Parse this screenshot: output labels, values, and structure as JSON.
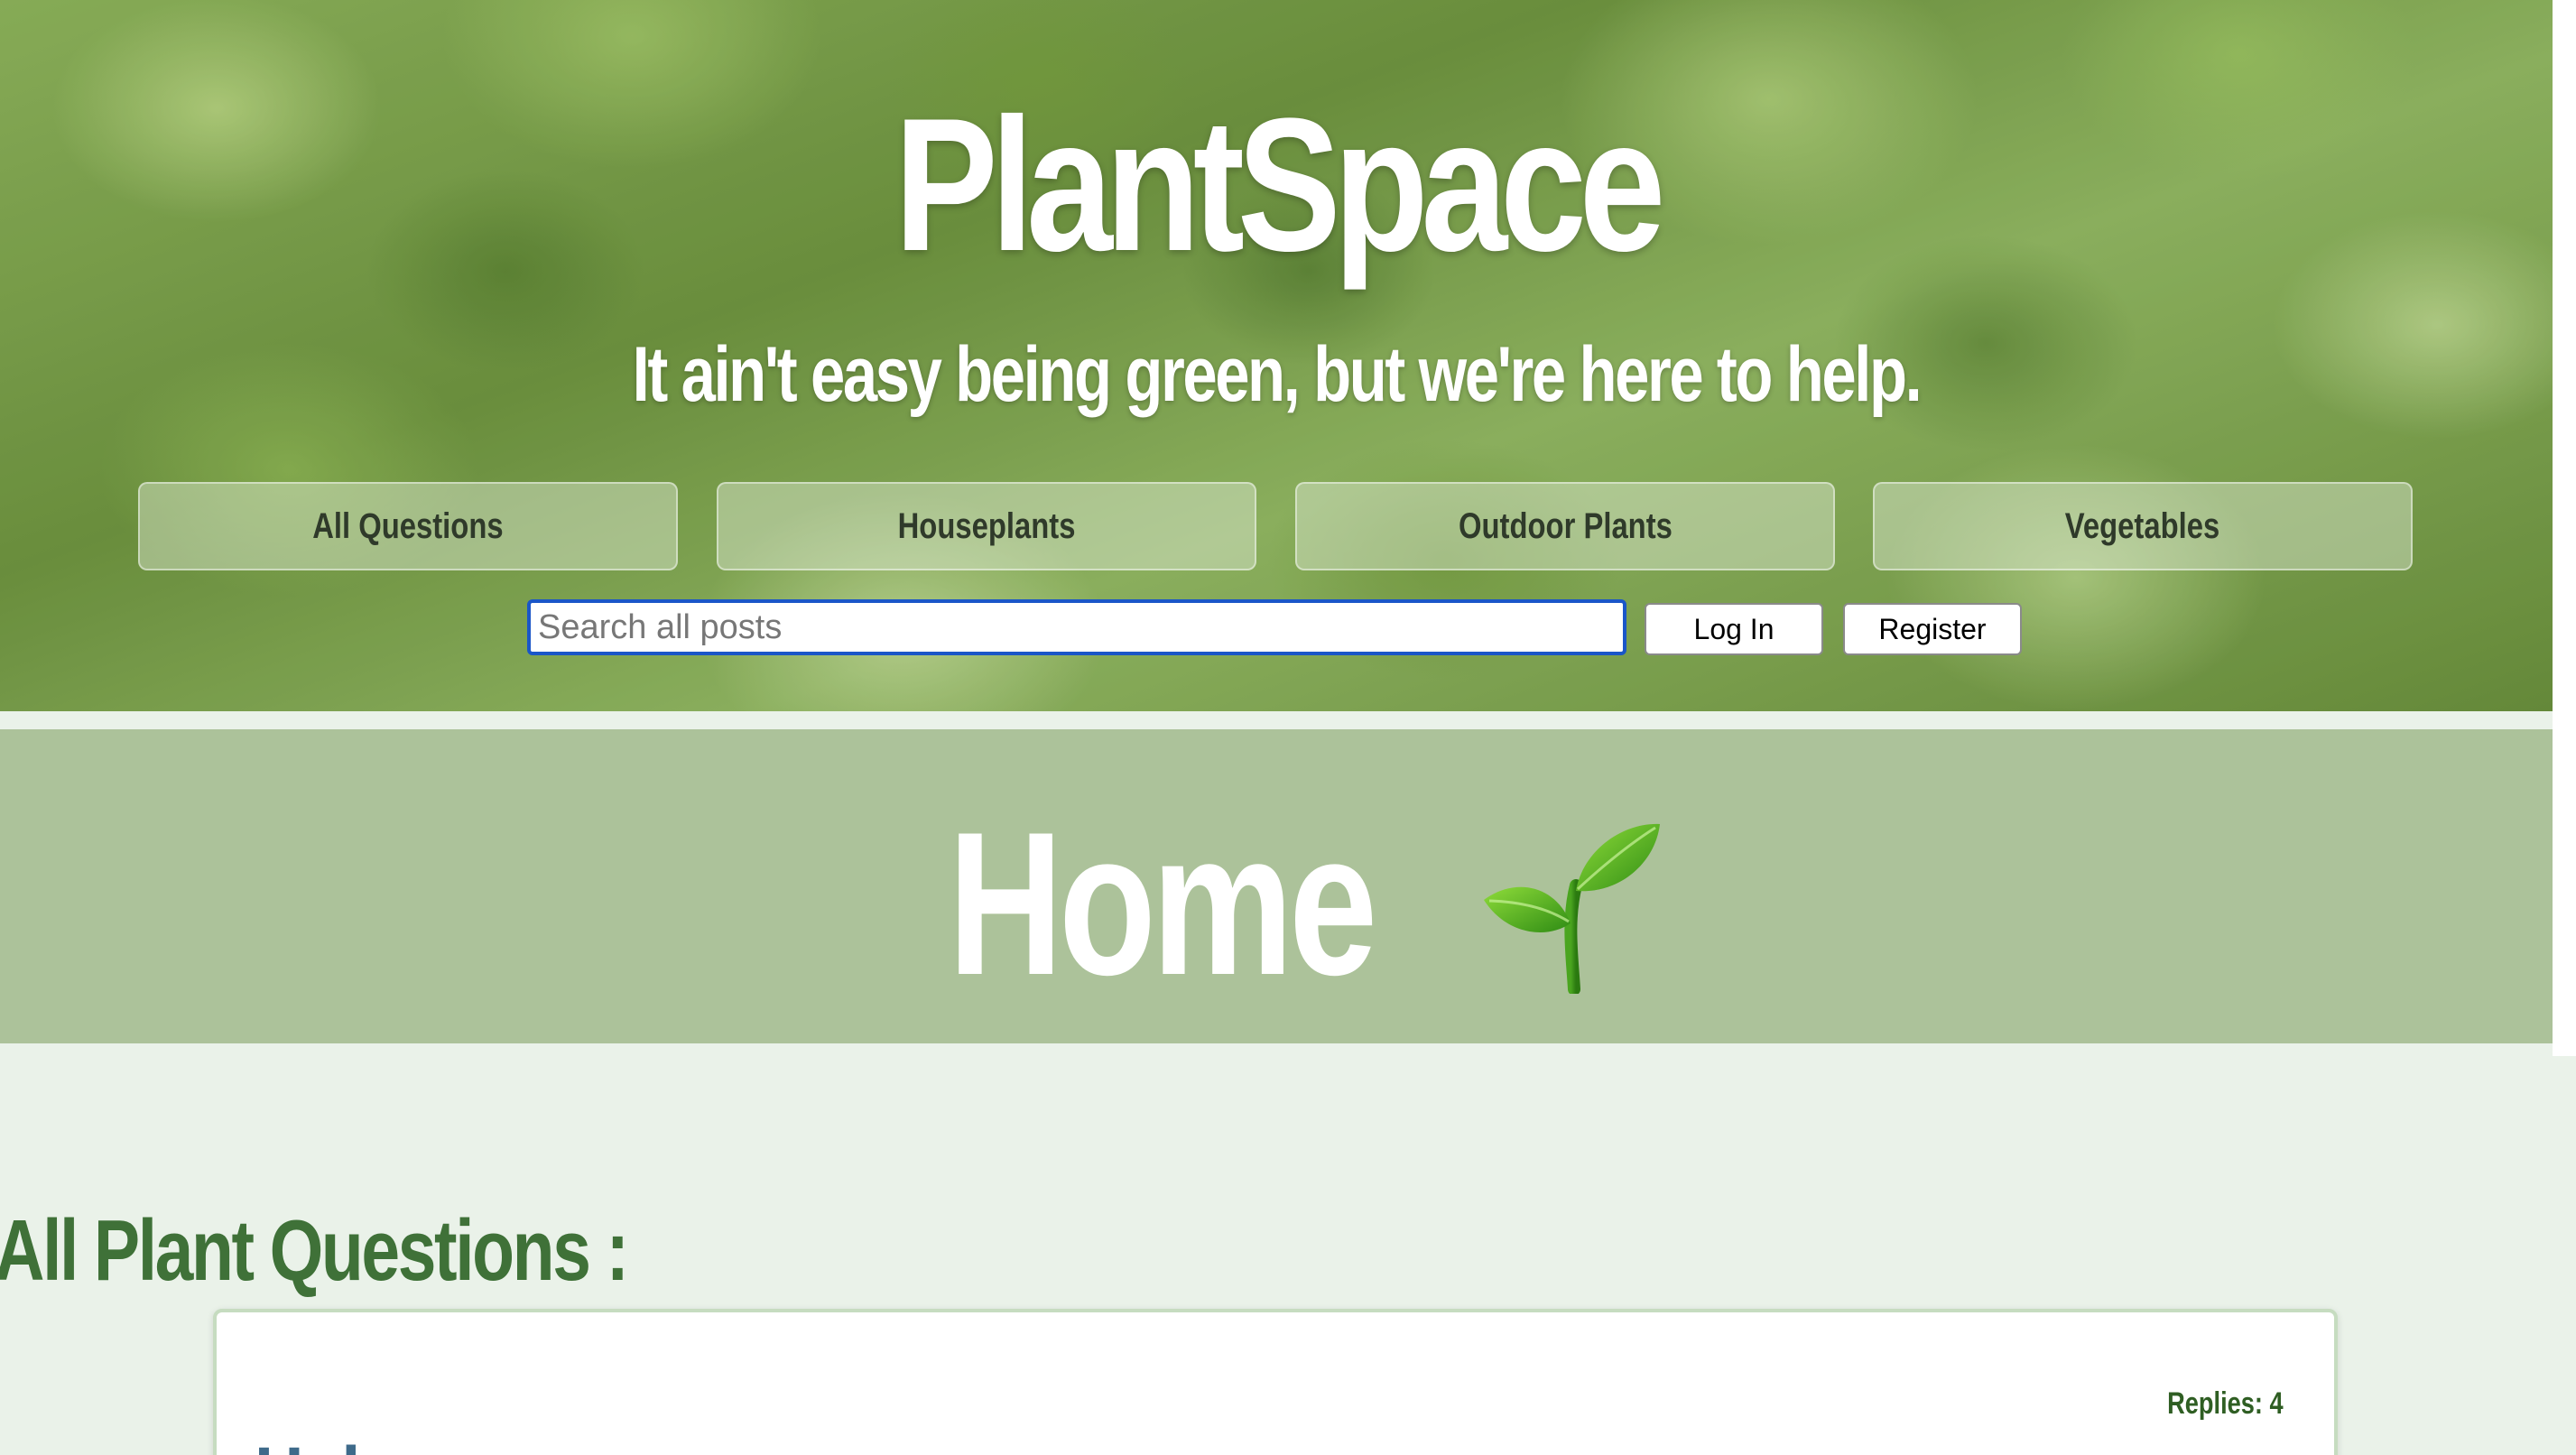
{
  "header": {
    "site_title": "PlantSpace",
    "tagline": "It ain't easy being green, but we're here to help."
  },
  "nav": {
    "items": [
      {
        "label": "All Questions"
      },
      {
        "label": "Houseplants"
      },
      {
        "label": "Outdoor Plants"
      },
      {
        "label": "Vegetables"
      }
    ]
  },
  "search": {
    "placeholder": "Search all posts",
    "value": ""
  },
  "auth": {
    "login_label": "Log In",
    "register_label": "Register"
  },
  "page": {
    "title": "Home",
    "title_icon": "sprout-icon"
  },
  "section": {
    "title": "All Plant Questions :"
  },
  "posts": [
    {
      "replies": "Replies: 4",
      "title": "Help"
    }
  ],
  "colors": {
    "band": "#acc29a",
    "background": "#eaf2e9",
    "section_title": "#3f7138",
    "replies": "#2f5e23",
    "post_title": "#3e6a8a",
    "search_focus": "#1a56c8"
  }
}
